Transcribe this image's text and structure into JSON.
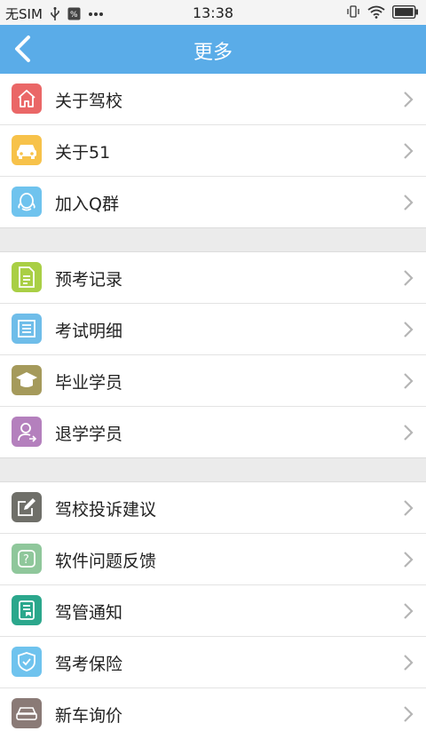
{
  "status_bar": {
    "carrier": "无SIM",
    "time": "13:38"
  },
  "nav": {
    "title": "更多"
  },
  "groups": [
    {
      "items": [
        {
          "label": "关于驾校",
          "icon": "home-icon",
          "color": "#ea6767"
        },
        {
          "label": "关于51",
          "icon": "car-icon",
          "color": "#f7c24a"
        },
        {
          "label": "加入Q群",
          "icon": "qq-icon",
          "color": "#6fc3ee"
        }
      ]
    },
    {
      "items": [
        {
          "label": "预考记录",
          "icon": "document-icon",
          "color": "#a9cf45"
        },
        {
          "label": "考试明细",
          "icon": "list-icon",
          "color": "#6fbde9"
        },
        {
          "label": "毕业学员",
          "icon": "graduation-cap-icon",
          "color": "#a59a5b"
        },
        {
          "label": "退学学员",
          "icon": "user-exit-icon",
          "color": "#b480bd"
        }
      ]
    },
    {
      "items": [
        {
          "label": "驾校投诉建议",
          "icon": "edit-icon",
          "color": "#6f6f69"
        },
        {
          "label": "软件问题反馈",
          "icon": "feedback-icon",
          "color": "#8fc79b"
        },
        {
          "label": "驾管通知",
          "icon": "notice-icon",
          "color": "#2ba78c"
        },
        {
          "label": "驾考保险",
          "icon": "shield-icon",
          "color": "#6fc3ee"
        },
        {
          "label": "新车询价",
          "icon": "car-price-icon",
          "color": "#8a7a76"
        }
      ]
    }
  ]
}
